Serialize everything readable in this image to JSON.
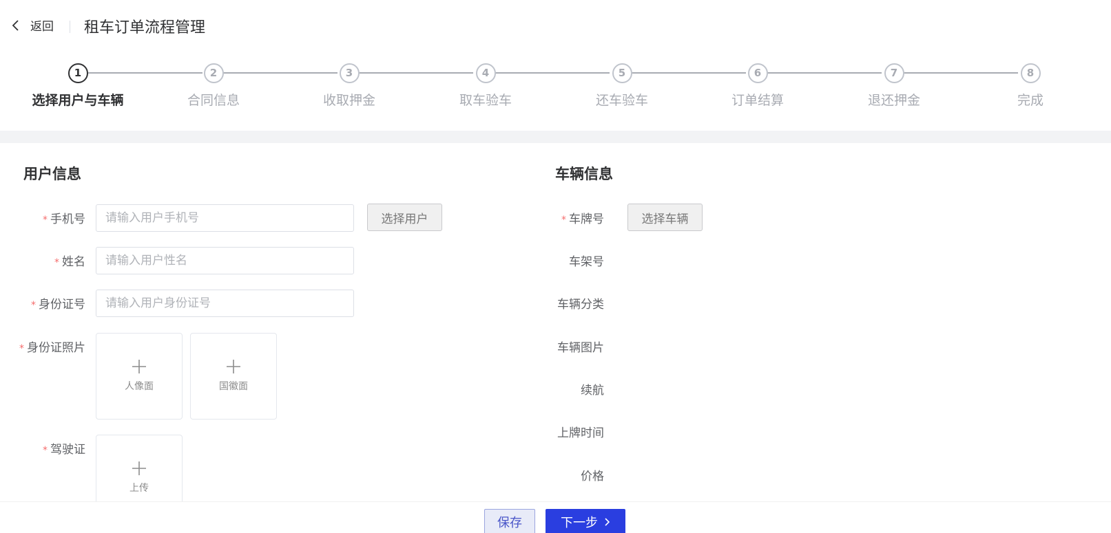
{
  "header": {
    "back_label": "返回",
    "title": "租车订单流程管理"
  },
  "steps": [
    {
      "number": "1",
      "title": "选择用户与车辆",
      "active": true
    },
    {
      "number": "2",
      "title": "合同信息",
      "active": false
    },
    {
      "number": "3",
      "title": "收取押金",
      "active": false
    },
    {
      "number": "4",
      "title": "取车验车",
      "active": false
    },
    {
      "number": "5",
      "title": "还车验车",
      "active": false
    },
    {
      "number": "6",
      "title": "订单结算",
      "active": false
    },
    {
      "number": "7",
      "title": "退还押金",
      "active": false
    },
    {
      "number": "8",
      "title": "完成",
      "active": false
    }
  ],
  "user_section": {
    "title": "用户信息",
    "required_mark": "*",
    "phone": {
      "label": "手机号",
      "placeholder": "请输入用户手机号",
      "value": ""
    },
    "select_user_button": "选择用户",
    "name": {
      "label": "姓名",
      "placeholder": "请输入用户性名",
      "value": ""
    },
    "id_number": {
      "label": "身份证号",
      "placeholder": "请输入用户身份证号",
      "value": ""
    },
    "id_photo": {
      "label": "身份证照片",
      "front": "人像面",
      "back": "国徽面"
    },
    "license": {
      "label": "驾驶证",
      "upload": "上传"
    }
  },
  "vehicle_section": {
    "title": "车辆信息",
    "required_mark": "*",
    "plate": {
      "label": "车牌号"
    },
    "select_vehicle_button": "选择车辆",
    "vin": {
      "label": "车架号"
    },
    "category": {
      "label": "车辆分类"
    },
    "image": {
      "label": "车辆图片"
    },
    "range": {
      "label": "续航"
    },
    "registration_time": {
      "label": "上牌时间"
    },
    "price": {
      "label": "价格"
    }
  },
  "footer": {
    "save_label": "保存",
    "next_label": "下一步"
  },
  "colors": {
    "primary": "#2a3ee0",
    "required": "#f56c6c",
    "band": "#f2f3f5"
  }
}
